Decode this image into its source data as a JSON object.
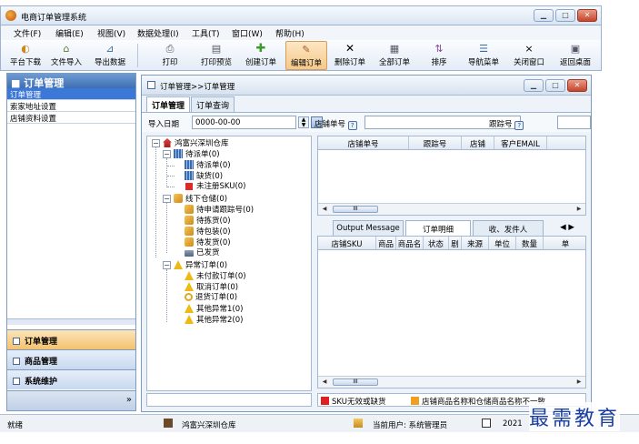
{
  "window": {
    "title": "电商订单管理系统"
  },
  "menu": [
    "文件(F)",
    "编辑(E)",
    "视图(V)",
    "数据处理(I)",
    "工具(T)",
    "窗口(W)",
    "帮助(H)"
  ],
  "toolbar": [
    {
      "label": "平台下载",
      "icon": "download-icon"
    },
    {
      "label": "文件导入",
      "icon": "import-icon"
    },
    {
      "label": "导出数据",
      "icon": "export-icon"
    },
    {
      "label": "打印",
      "icon": "print-icon"
    },
    {
      "label": "打印预览",
      "icon": "print-preview-icon"
    },
    {
      "label": "创建订单",
      "icon": "plus-icon"
    },
    {
      "label": "编辑订单",
      "icon": "edit-icon",
      "active": true
    },
    {
      "label": "删除订单",
      "icon": "delete-icon"
    },
    {
      "label": "全部订单",
      "icon": "all-orders-icon"
    },
    {
      "label": "排序",
      "icon": "sort-icon"
    },
    {
      "label": "导航菜单",
      "icon": "nav-menu-icon"
    },
    {
      "label": "关闭窗口",
      "icon": "close-window-icon"
    },
    {
      "label": "返回桌面",
      "icon": "desktop-icon"
    }
  ],
  "sidebar": {
    "header": "订单管理",
    "items": [
      "订单管理",
      "索家地址设置",
      "店铺资料设置"
    ],
    "selected": 0,
    "nav": [
      "订单管理",
      "商品管理",
      "系统维护"
    ],
    "nav_active": 0,
    "more": "»"
  },
  "inner": {
    "title": "订单管理>>订单管理",
    "tabs": [
      "订单管理",
      "订单查询"
    ],
    "active_tab": 0,
    "filter": {
      "date_label": "导入日期",
      "date_value": "0000-00-00",
      "shop_order_label": "店铺单号",
      "tracking_label": "跟踪号",
      "help": "?"
    }
  },
  "tree": {
    "root": "鸿富兴深圳仓库",
    "groups": [
      {
        "label": "待派单(0)",
        "children": [
          "待派单(0)",
          "缺货(0)",
          "未注册SKU(0)"
        ]
      },
      {
        "label": "线下仓储(0)",
        "children": [
          "待申请跟踪号(0)",
          "待拣货(0)",
          "待包装(0)",
          "待发货(0)",
          "已发货"
        ]
      },
      {
        "label": "异常订单(0)",
        "children": [
          "未付款订单(0)",
          "取消订单(0)",
          "退货订单(0)",
          "其他异常1(0)",
          "其他异常2(0)"
        ]
      }
    ]
  },
  "grid_top": {
    "columns": [
      "店铺单号",
      "跟踪号",
      "店铺",
      "客户EMAIL"
    ],
    "scroll_thumb": "III"
  },
  "detail_tabs": [
    "Output Message",
    "订单明细",
    "收、发件人"
  ],
  "detail_active": 1,
  "grid_bottom": {
    "columns": [
      "店铺SKU",
      "商品",
      "商品名",
      "状态",
      "剧",
      "来源",
      "单位",
      "数量",
      "单"
    ],
    "scroll_thumb": "III"
  },
  "legend": [
    {
      "color": "#e02020",
      "label": "SKU无效或缺货"
    },
    {
      "color": "#f0a020",
      "label": "店铺商品名称和仓储商品名称不一致"
    }
  ],
  "status": {
    "ready": "就绪",
    "warehouse": "鸿富兴深圳仓库",
    "user": "当前用户: 系统管理员",
    "date": "2021"
  },
  "watermark": "最需教育"
}
